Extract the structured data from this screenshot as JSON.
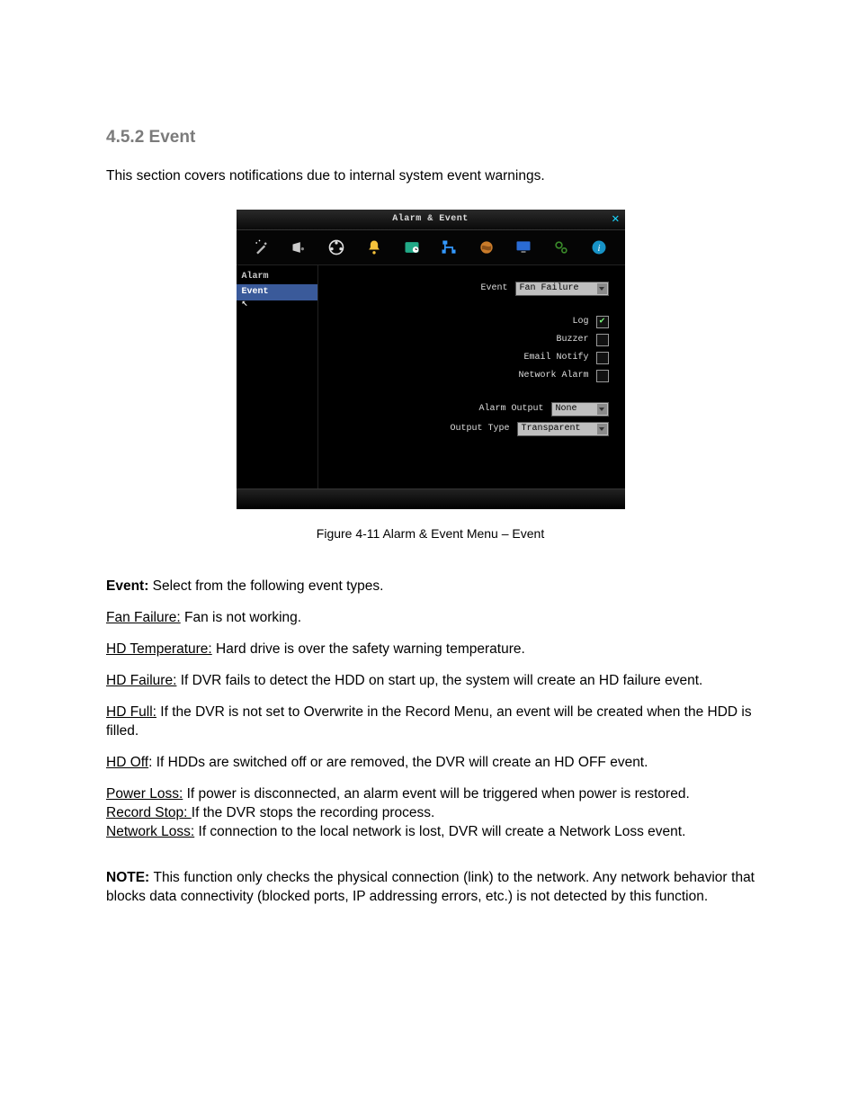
{
  "heading": "4.5.2 Event",
  "intro": "This section covers notifications due to internal system event warnings.",
  "dialog": {
    "title": "Alarm & Event",
    "close": "✕",
    "side": {
      "item0": "Alarm",
      "item1": "Event"
    },
    "labels": {
      "event": "Event",
      "log": "Log",
      "buzzer": "Buzzer",
      "email": "Email Notify",
      "network": "Network Alarm",
      "alarm_output": "Alarm Output",
      "output_type": "Output Type"
    },
    "values": {
      "event": "Fan Failure",
      "alarm_output": "None",
      "output_type": "Transparent"
    }
  },
  "caption": "Figure 4-11  Alarm & Event Menu – Event",
  "defs": {
    "event_label": "Event:",
    "event_text": " Select from the following event types.",
    "fan_label": "Fan Failure:",
    "fan_text": " Fan is not working.",
    "hdtemp_label": "HD Temperature:",
    "hdtemp_text": " Hard drive is over the safety warning temperature.",
    "hdfail_label": "HD Failure:",
    "hdfail_text": " If DVR fails to detect the HDD on start up, the system will create an HD failure event.",
    "hdfull_label": "HD Full:",
    "hdfull_text": " If the DVR is not set to Overwrite in the Record Menu, an event will be created when the HDD is filled.",
    "hdoff_label": "HD Off",
    "hdoff_text": ": If HDDs are switched off or are removed, the DVR will create an HD OFF event.",
    "power_label": "Power Loss:",
    "power_text": " If power is disconnected, an alarm event will be triggered when power is restored.",
    "recstop_label": "Record Stop: ",
    "recstop_text": "If the DVR stops the recording process.",
    "netloss_label": "Network Loss:",
    "netloss_text": " If connection to the local network is lost, DVR will create a Network Loss event."
  },
  "note_label": "NOTE:",
  "note_text": " This function only checks the physical connection (link) to the network. Any network behavior that blocks data connectivity (blocked ports, IP addressing errors, etc.) is not detected by this function."
}
